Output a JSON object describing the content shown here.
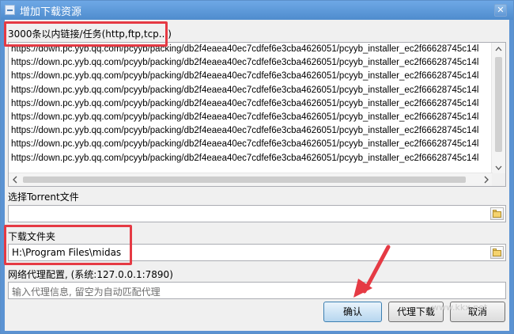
{
  "window": {
    "title": "增加下载资源",
    "close_glyph": "✕",
    "colors": {
      "titlebar": "#5b93d3",
      "highlight": "#e53a44"
    }
  },
  "url_section": {
    "label": "3000条以内链接/任务(http,ftp,tcp...)",
    "lines": [
      "https://down.pc.yyb.qq.com/pcyyb/packing/db2f4eaea40ec7cdfef6e3cba4626051/pcyyb_installer_ec2f66628745c14l",
      "https://down.pc.yyb.qq.com/pcyyb/packing/db2f4eaea40ec7cdfef6e3cba4626051/pcyyb_installer_ec2f66628745c14l",
      "https://down.pc.yyb.qq.com/pcyyb/packing/db2f4eaea40ec7cdfef6e3cba4626051/pcyyb_installer_ec2f66628745c14l",
      "https://down.pc.yyb.qq.com/pcyyb/packing/db2f4eaea40ec7cdfef6e3cba4626051/pcyyb_installer_ec2f66628745c14l",
      "https://down.pc.yyb.qq.com/pcyyb/packing/db2f4eaea40ec7cdfef6e3cba4626051/pcyyb_installer_ec2f66628745c14l",
      "https://down.pc.yyb.qq.com/pcyyb/packing/db2f4eaea40ec7cdfef6e3cba4626051/pcyyb_installer_ec2f66628745c14l",
      "https://down.pc.yyb.qq.com/pcyyb/packing/db2f4eaea40ec7cdfef6e3cba4626051/pcyyb_installer_ec2f66628745c14l",
      "https://down.pc.yyb.qq.com/pcyyb/packing/db2f4eaea40ec7cdfef6e3cba4626051/pcyyb_installer_ec2f66628745c14l",
      "https://down.pc.yyb.qq.com/pcyyb/packing/db2f4eaea40ec7cdfef6e3cba4626051/pcyyb_installer_ec2f66628745c14l"
    ]
  },
  "torrent": {
    "label": "选择Torrent文件",
    "value": ""
  },
  "folder": {
    "label": "下载文件夹",
    "value": "H:\\Program Files\\midas"
  },
  "proxy": {
    "label": "网络代理配置, (系统:127.0.0.1:7890)",
    "placeholder": "输入代理信息, 留空为自动匹配代理"
  },
  "buttons": {
    "ok": "确认",
    "proxy_download": "代理下载",
    "cancel": "取消"
  },
  "watermark": "www.kkx.net"
}
